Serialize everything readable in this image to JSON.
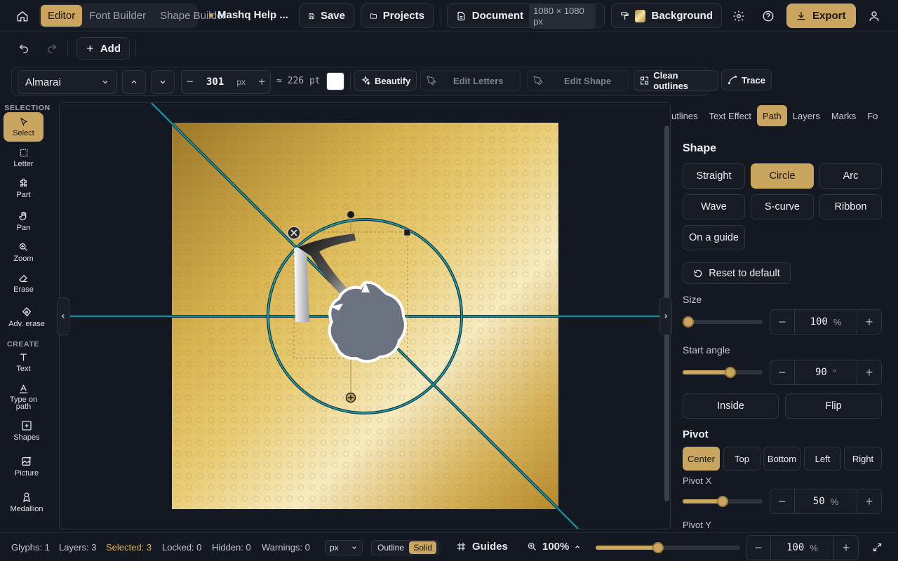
{
  "topbar": {
    "modes": [
      "Editor",
      "Font Builder",
      "Shape Builder"
    ],
    "help_label": "Mashq Help ...",
    "save_label": "Save",
    "projects_label": "Projects",
    "document_label": "Document",
    "document_size": "1080 × 1080 px",
    "background_label": "Background",
    "export_label": "Export"
  },
  "row2": {
    "add_label": "Add"
  },
  "toolbar": {
    "font_name": "Almarai",
    "size_value": "301",
    "size_unit": "px",
    "pt_value": "≈ 226 pt",
    "beautify_label": "Beautify",
    "edit_letters_label": "Edit Letters",
    "edit_shape_label": "Edit Shape",
    "clean_outlines_label": "Clean outlines",
    "trace_label": "Trace",
    "fill_color": "#ffffff"
  },
  "toolbox": {
    "selection_header": "SELECTION",
    "create_header": "CREATE",
    "tools": {
      "select": "Select",
      "letter": "Letter",
      "part": "Part",
      "pan": "Pan",
      "zoom": "Zoom",
      "erase": "Erase",
      "adv_erase": "Adv. erase",
      "text": "Text",
      "type_on_path": "Type on path",
      "shapes": "Shapes",
      "picture": "Picture",
      "medallion": "Medallion"
    }
  },
  "panel": {
    "tabs": [
      "utlines",
      "Text Effect",
      "Path",
      "Layers",
      "Marks",
      "Fo"
    ],
    "active_tab": "Path",
    "shape_heading": "Shape",
    "shapes": [
      "Straight",
      "Circle",
      "Arc",
      "Wave",
      "S-curve",
      "Ribbon",
      "On a guide"
    ],
    "active_shape": "Circle",
    "reset_label": "Reset to default",
    "size_label": "Size",
    "size_value": "100",
    "size_unit": "%",
    "size_fraction": 0.05,
    "start_angle_label": "Start angle",
    "start_angle_value": "90",
    "start_angle_unit": "°",
    "start_angle_fraction": 0.6,
    "inside_label": "Inside",
    "flip_label": "Flip",
    "pivot_heading": "Pivot",
    "pivots": [
      "Center",
      "Top",
      "Bottom",
      "Left",
      "Right"
    ],
    "active_pivot": "Center",
    "pivot_x_label": "Pivot X",
    "pivot_x_value": "50",
    "pivot_x_unit": "%",
    "pivot_x_fraction": 0.5,
    "pivot_y_label": "Pivot Y"
  },
  "status": {
    "glyphs": "Glyphs: 1",
    "layers": "Layers: 3",
    "selected": "Selected: 3",
    "locked": "Locked: 0",
    "hidden": "Hidden: 0",
    "warnings": "Warnings: 0",
    "unit": "px",
    "outline_label": "Outline",
    "solid_label": "Solid",
    "guides_label": "Guides",
    "zoom": "100%",
    "zoom_slider_fraction": 0.43,
    "zoom_value": "100",
    "zoom_unit": "%"
  },
  "colors": {
    "accent": "#c9a560",
    "guide": "#1aa6b8",
    "shape_fill": "#6b7280"
  }
}
